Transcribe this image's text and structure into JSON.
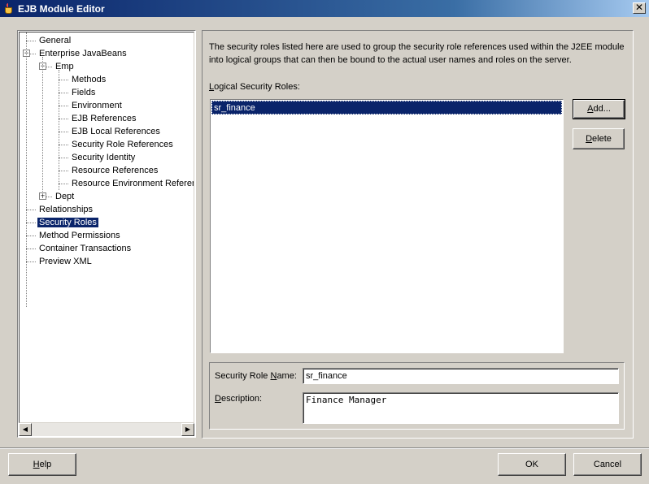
{
  "window": {
    "title": "EJB Module Editor",
    "close_glyph": "✕"
  },
  "tree": {
    "items": [
      {
        "label": "General",
        "level": 0
      },
      {
        "label": "Enterprise JavaBeans",
        "level": 0,
        "expander": "−"
      },
      {
        "label": "Emp",
        "level": 1,
        "expander": "−"
      },
      {
        "label": "Methods",
        "level": 2
      },
      {
        "label": "Fields",
        "level": 2
      },
      {
        "label": "Environment",
        "level": 2
      },
      {
        "label": "EJB References",
        "level": 2
      },
      {
        "label": "EJB Local References",
        "level": 2
      },
      {
        "label": "Security Role References",
        "level": 2
      },
      {
        "label": "Security Identity",
        "level": 2
      },
      {
        "label": "Resource References",
        "level": 2
      },
      {
        "label": "Resource Environment References",
        "level": 2
      },
      {
        "label": "Dept",
        "level": 1,
        "expander": "+"
      },
      {
        "label": "Relationships",
        "level": 0
      },
      {
        "label": "Security Roles",
        "level": 0,
        "selected": true
      },
      {
        "label": "Method Permissions",
        "level": 0
      },
      {
        "label": "Container Transactions",
        "level": 0
      },
      {
        "label": "Preview XML",
        "level": 0
      }
    ],
    "scroll_left": "◀",
    "scroll_right": "▶"
  },
  "main": {
    "description": "The security roles listed here are used to group the security role references used within the J2EE module into logical groups that can then be bound to the actual user names and roles on the server.",
    "list_label_mnemonic": "L",
    "list_label_rest": "ogical Security Roles:",
    "roles": [
      "sr_finance"
    ],
    "add_button_mnemonic": "A",
    "add_button_rest": "dd...",
    "delete_button_mnemonic": "D",
    "delete_button_rest": "elete",
    "role_name_label_pre": "Security Role ",
    "role_name_label_mnemonic": "N",
    "role_name_label_post": "ame:",
    "role_name_value": "sr_finance",
    "description_label_pre": "",
    "description_label_mnemonic": "D",
    "description_label_post": "escription:",
    "description_value": "Finance Manager"
  },
  "footer": {
    "help_mnemonic": "H",
    "help_rest": "elp",
    "ok_label": "OK",
    "cancel_label": "Cancel"
  }
}
